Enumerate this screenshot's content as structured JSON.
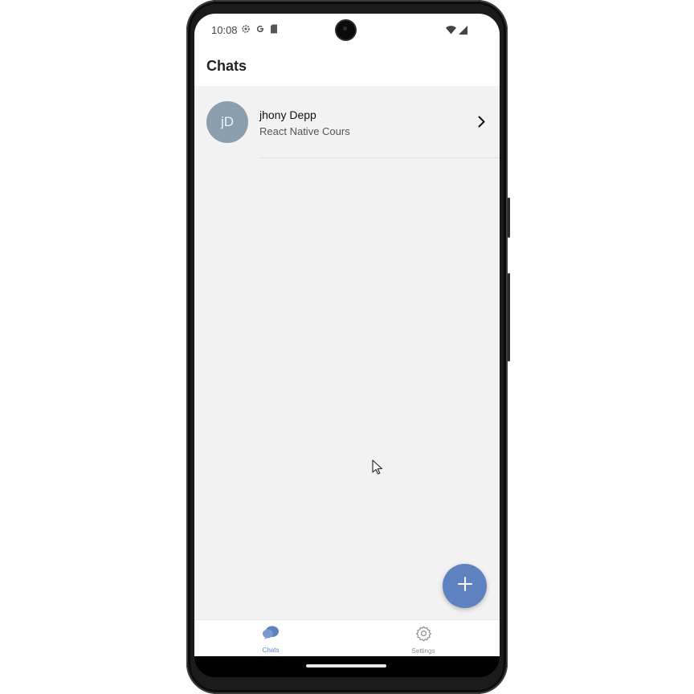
{
  "status_bar": {
    "time": "10:08",
    "icons_left": [
      "gear-icon",
      "google-icon",
      "sd-card-icon"
    ],
    "icons_right": [
      "wifi-icon",
      "signal-icon"
    ]
  },
  "header": {
    "title": "Chats"
  },
  "chats": [
    {
      "initials": "jD",
      "name": "jhony Depp",
      "preview": "React Native Cours"
    }
  ],
  "fab": {
    "icon": "plus-icon"
  },
  "tabs": [
    {
      "label": "Chats",
      "icon": "chat-bubbles-icon",
      "active": true
    },
    {
      "label": "Settings",
      "icon": "gear-icon",
      "active": false
    }
  ],
  "colors": {
    "accent": "#5e82c0",
    "avatar": "#8b9eae",
    "content_bg": "#f2f2f2",
    "tab_active": "#5e82c0",
    "tab_inactive": "#8e8e93"
  }
}
